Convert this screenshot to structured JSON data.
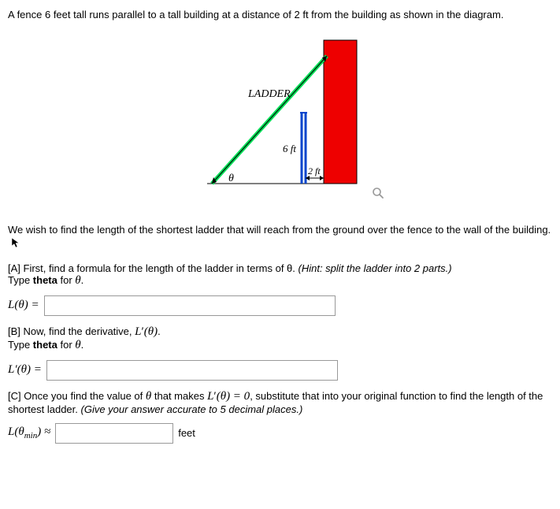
{
  "problem_statement": "A fence 6 feet tall runs parallel to a tall building at a distance of 2 ft from the building as shown in the diagram.",
  "diagram": {
    "ladder_label": "LADDER",
    "theta_label": "θ",
    "fence_height_label": "6 ft",
    "gap_label": "2 ft"
  },
  "question_text": "We wish to find the length of the shortest ladder that will reach from the ground over the fence to the wall of the building.",
  "partA": {
    "prompt_prefix": "[A] First, find a formula for the length of the ladder in terms of θ. ",
    "hint": "(Hint: split the ladder into 2 parts.)",
    "type_instr": "Type theta for θ.",
    "lhs": "L(θ) ="
  },
  "partB": {
    "prompt": "[B] Now, find the derivative, L′(θ).",
    "type_instr": "Type theta for θ.",
    "lhs": "L′(θ) ="
  },
  "partC": {
    "prompt_prefix": "[C] Once you find the value of θ that makes L′(θ) = 0, substitute that into your original function to find the length of the shortest ladder. ",
    "hint": "(Give your answer accurate to 5 decimal places.)",
    "lhs_prefix": "L(θ",
    "lhs_sub": "min",
    "lhs_suffix": ") ≈",
    "unit": "feet"
  }
}
